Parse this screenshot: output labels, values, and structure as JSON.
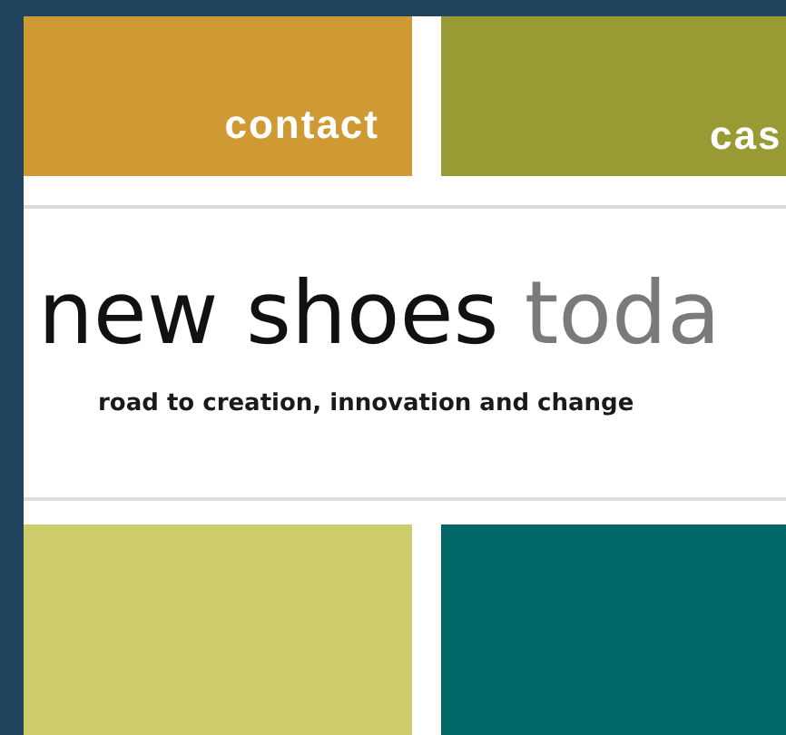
{
  "top_tiles": [
    {
      "label": "contact",
      "color": "#cf9a33"
    },
    {
      "label": "cas",
      "color": "#989a33"
    }
  ],
  "header": {
    "title": "new shoes",
    "title_accent": "toda",
    "tagline": "road to creation, innovation and change"
  },
  "bottom_tiles": [
    {
      "color": "#cccc6a"
    },
    {
      "color": "#006766"
    }
  ]
}
